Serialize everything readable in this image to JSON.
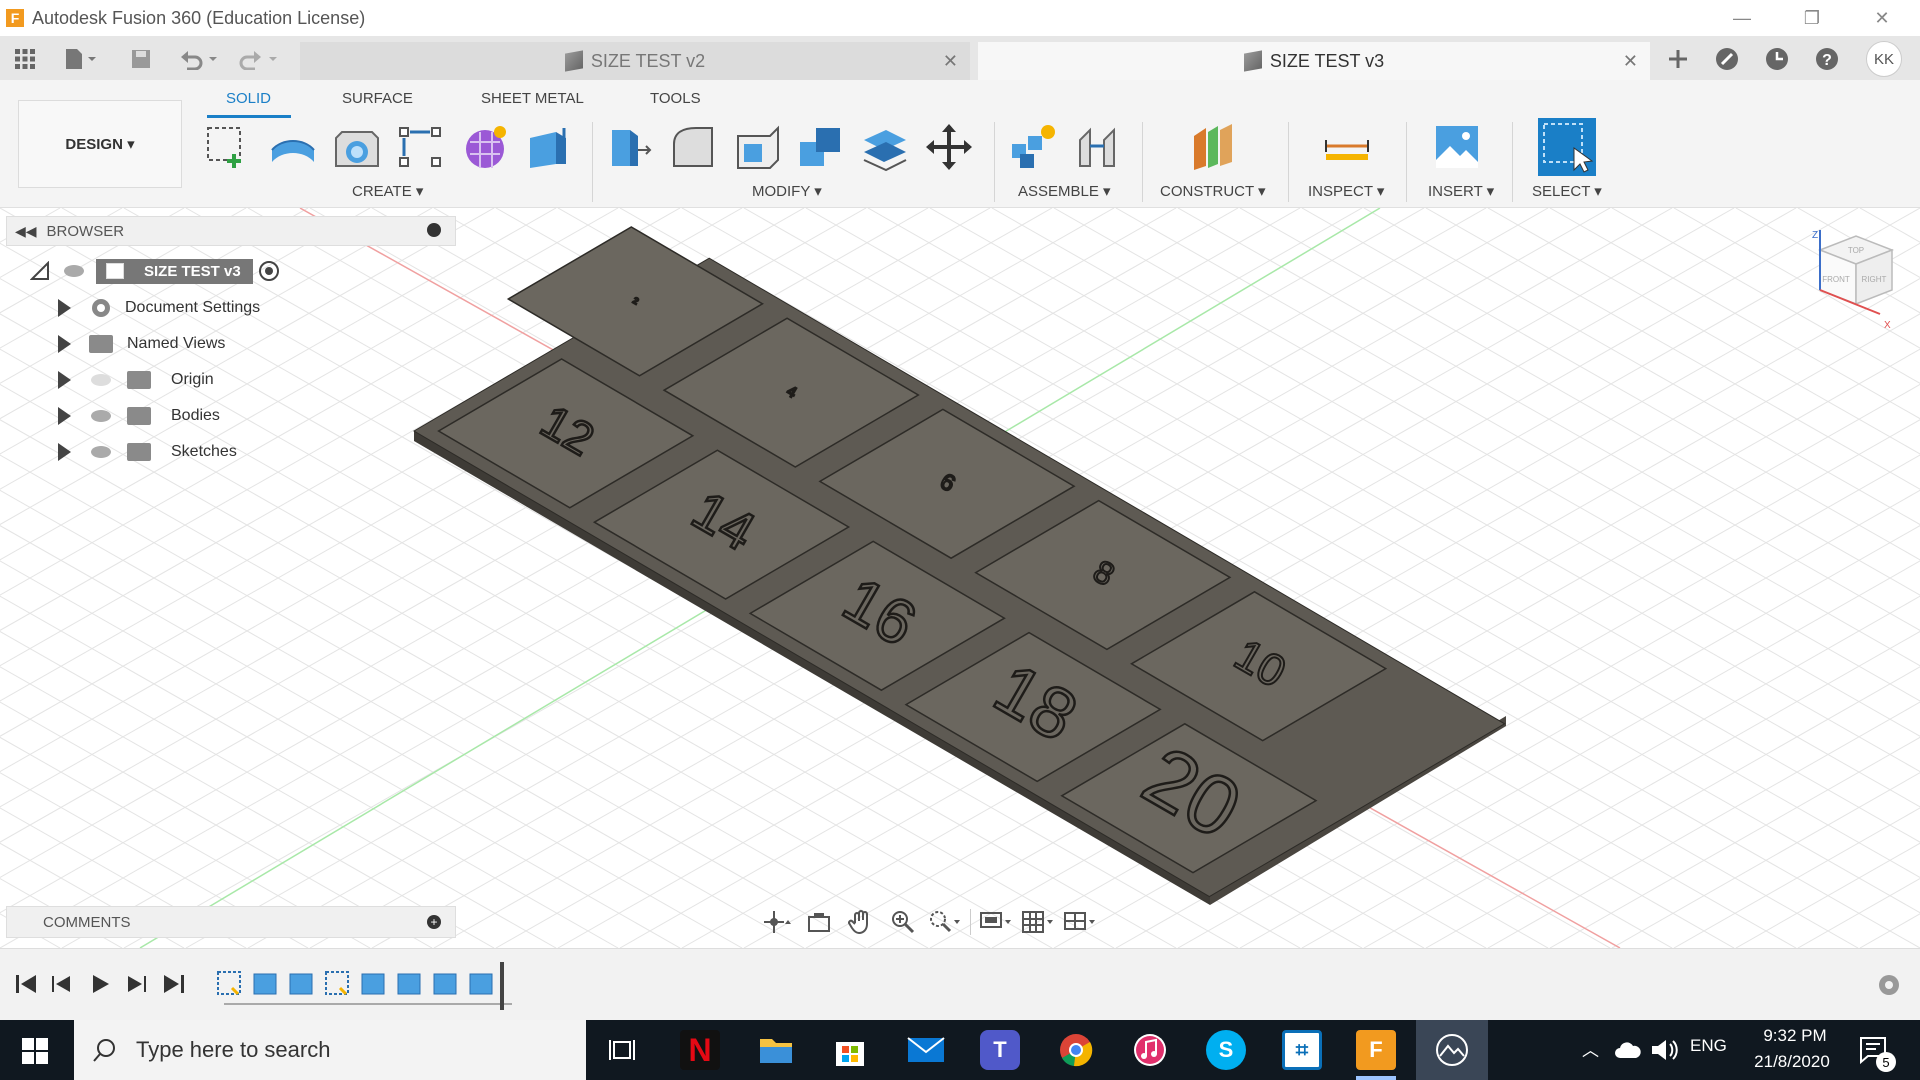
{
  "window": {
    "title": "Autodesk Fusion 360 (Education License)",
    "logo_letter": "F",
    "min_glyph": "—",
    "restore_glyph": "❐",
    "close_glyph": "✕"
  },
  "tabs": [
    {
      "label": "SIZE TEST v2",
      "active": false,
      "close": "✕"
    },
    {
      "label": "SIZE TEST v3",
      "active": true,
      "close": "✕"
    }
  ],
  "user_initials": "KK",
  "workspace": {
    "design_label": "DESIGN ▾",
    "tabs": [
      "SOLID",
      "SURFACE",
      "SHEET METAL",
      "TOOLS"
    ],
    "groups": [
      "CREATE ▾",
      "MODIFY ▾",
      "ASSEMBLE ▾",
      "CONSTRUCT ▾",
      "INSPECT ▾",
      "INSERT ▾",
      "SELECT ▾"
    ]
  },
  "browser": {
    "header": "BROWSER",
    "root": "SIZE TEST v3",
    "items": [
      "Document Settings",
      "Named Views",
      "Origin",
      "Bodies",
      "Sketches"
    ]
  },
  "comments": {
    "header": "COMMENTS"
  },
  "model": {
    "tiles": [
      "12",
      "14",
      "16",
      "18",
      "20",
      "2",
      "4",
      "6",
      "8",
      "10"
    ],
    "tile_color": "#6b675f",
    "base_color": "#5e5a53"
  },
  "viewcube": {
    "face_top": "TOP",
    "face_front": "FRONT",
    "face_right": "RIGHT",
    "axis_z": "Z",
    "axis_x": "X"
  },
  "taskbar": {
    "search_placeholder": "Type here to search",
    "language": "ENG",
    "time": "9:32 PM",
    "date": "21/8/2020",
    "notification_count": "5"
  },
  "colors": {
    "accent": "#1a7fc7",
    "taskbar": "#101820"
  }
}
